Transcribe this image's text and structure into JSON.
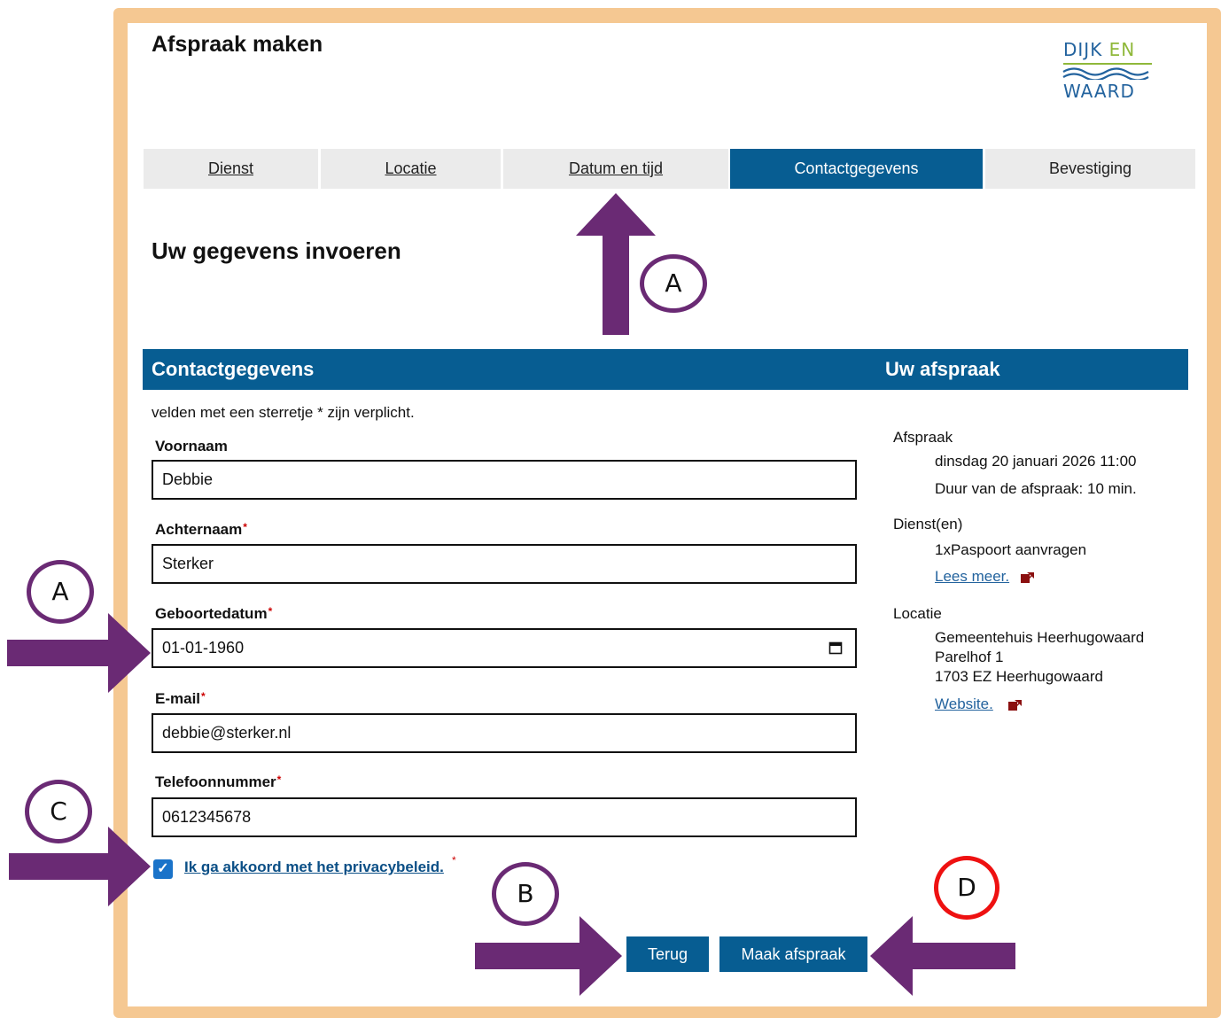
{
  "header": {
    "title": "Afspraak maken",
    "logo": {
      "line1_a": "DIJK ",
      "line1_b": "EN",
      "line2": "WAARD"
    }
  },
  "tabs": [
    {
      "label": "Dienst",
      "state": "link"
    },
    {
      "label": "Locatie",
      "state": "link"
    },
    {
      "label": "Datum en tijd",
      "state": "link"
    },
    {
      "label": "Contactgegevens",
      "state": "active"
    },
    {
      "label": "Bevestiging",
      "state": "plain"
    }
  ],
  "section_title": "Uw gegevens invoeren",
  "bar": {
    "left": "Contactgegevens",
    "right": "Uw afspraak"
  },
  "form": {
    "required_note": "velden met een sterretje * zijn verplicht.",
    "fields": [
      {
        "label": "Voornaam",
        "required": false,
        "value": "Debbie"
      },
      {
        "label": "Achternaam",
        "required": true,
        "value": "Sterker"
      },
      {
        "label": "Geboortedatum",
        "required": true,
        "value": "01-01-1960"
      },
      {
        "label": "E-mail",
        "required": true,
        "value": "debbie@sterker.nl"
      },
      {
        "label": "Telefoonnummer",
        "required": true,
        "value": "0612345678"
      }
    ],
    "star": "*",
    "privacy": {
      "label": "Ik ga akkoord met het privacybeleid.",
      "checked": true
    }
  },
  "buttons": {
    "back": "Terug",
    "submit": "Maak afspraak"
  },
  "appointment": {
    "afspraak_heading": "Afspraak",
    "datetime": "dinsdag 20 januari 2026 11:00",
    "duration": "Duur van de afspraak: 10 min.",
    "dienst_heading": "Dienst(en)",
    "dienst": "1xPaspoort aanvragen",
    "read_more": "Lees meer.",
    "locatie_heading": "Locatie",
    "location_name": "Gemeentehuis Heerhugowaard",
    "address_line1": "Parelhof 1",
    "address_line2": "1703 EZ Heerhugowaard",
    "website": "Website."
  },
  "annotations": {
    "a": "A",
    "b": "B",
    "c": "C",
    "d": "D"
  },
  "colors": {
    "primary": "#075d92",
    "frame": "#f5c892",
    "arrow": "#6a2a74",
    "marker_d": "#ee1111",
    "checkbox": "#1a73c9"
  }
}
